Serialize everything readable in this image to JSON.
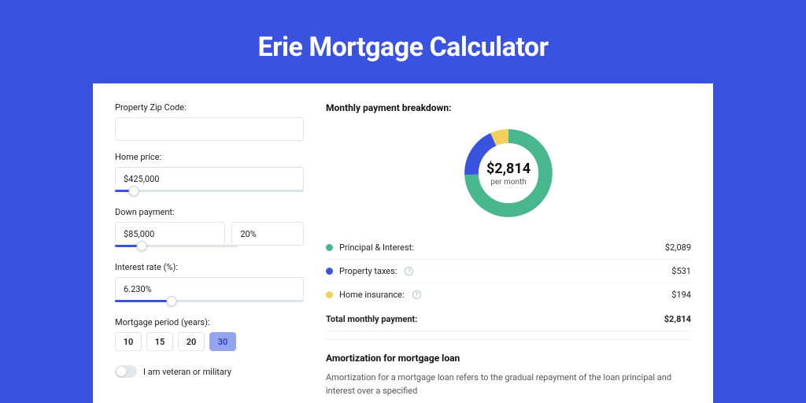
{
  "title": "Erie Mortgage Calculator",
  "labels": {
    "zip": "Property Zip Code:",
    "home_price": "Home price:",
    "down_payment": "Down payment:",
    "interest_rate": "Interest rate (%):",
    "mortgage_period": "Mortgage period (years):",
    "veteran": "I am veteran or military"
  },
  "values": {
    "zip": "",
    "home_price": "$425,000",
    "down_payment_amount": "$85,000",
    "down_payment_pct": "20%",
    "interest_rate": "6.230%"
  },
  "sliders": {
    "home_price_pct": 10,
    "down_payment_pct": 22,
    "interest_rate_pct": 30
  },
  "periods": {
    "options": [
      "10",
      "15",
      "20",
      "30"
    ],
    "active": "30"
  },
  "breakdown": {
    "title": "Monthly payment breakdown:",
    "total": "$2,814",
    "per_month": "per month",
    "items": [
      {
        "label": "Principal & Interest:",
        "value": "$2,089",
        "color": "#49b78e",
        "has_info": false
      },
      {
        "label": "Property taxes:",
        "value": "$531",
        "color": "#3953e0",
        "has_info": true
      },
      {
        "label": "Home insurance:",
        "value": "$194",
        "color": "#f5cf5b",
        "has_info": true
      }
    ],
    "total_label": "Total monthly payment:",
    "total_value": "$2,814"
  },
  "chart_data": {
    "type": "pie",
    "title": "Monthly payment breakdown",
    "series": [
      {
        "name": "Principal & Interest",
        "value": 2089,
        "color": "#49b78e"
      },
      {
        "name": "Property taxes",
        "value": 531,
        "color": "#3953e0"
      },
      {
        "name": "Home insurance",
        "value": 194,
        "color": "#f5cf5b"
      }
    ],
    "total": 2814,
    "center_label": "$2,814",
    "center_sub": "per month"
  },
  "amortization": {
    "title": "Amortization for mortgage loan",
    "text": "Amortization for a mortgage loan refers to the gradual repayment of the loan principal and interest over a specified"
  }
}
